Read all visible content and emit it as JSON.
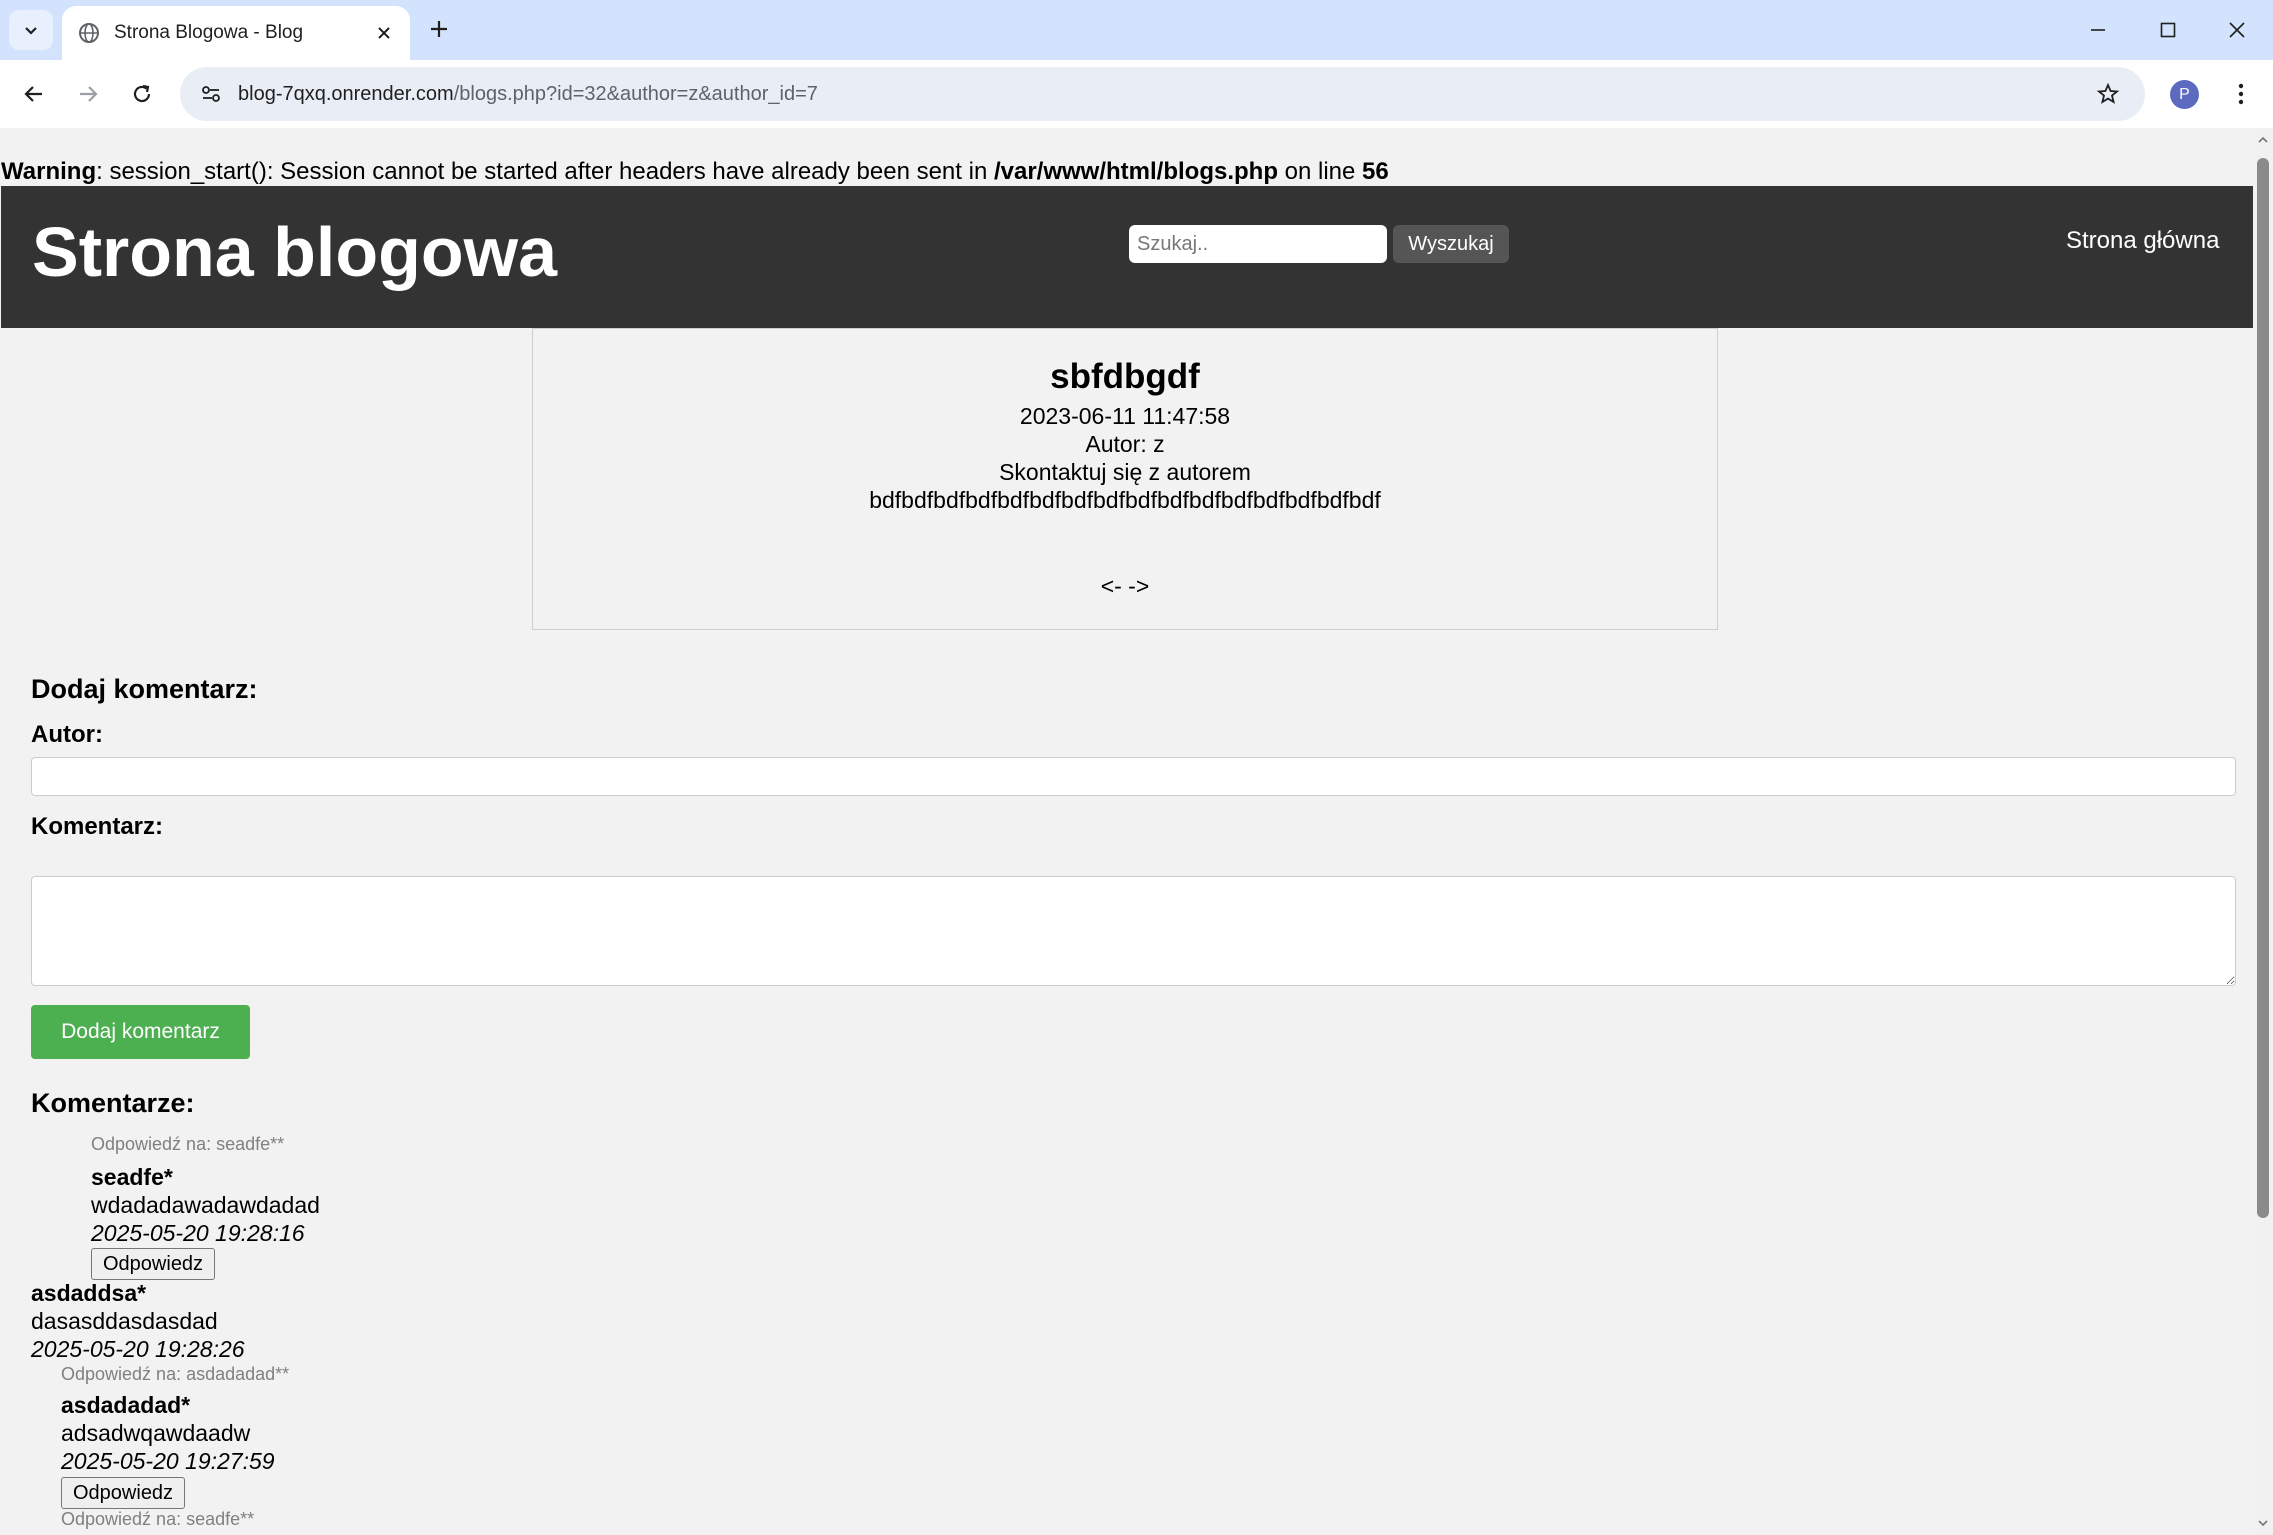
{
  "browser": {
    "tab_title": "Strona Blogowa - Blog",
    "url_host": "blog-7qxq.onrender.com",
    "url_path": "/blogs.php?id=32&author=z&author_id=7",
    "profile_initial": "P"
  },
  "warning": {
    "label": "Warning",
    "message": ": session_start(): Session cannot be started after headers have already been sent in ",
    "file": "/var/www/html/blogs.php",
    "on_line": " on line ",
    "line": "56"
  },
  "header": {
    "title": "Strona blogowa",
    "search_placeholder": "Szukaj..",
    "search_button": "Wyszukaj",
    "home_link": "Strona główna"
  },
  "post": {
    "title": "sbfdbgdf",
    "date": "2023-06-11 11:47:58",
    "author": "Autor: z",
    "contact": "Skontaktuj się z autorem",
    "body": "bdfbdfbdfbdfbdfbdfbdfbdfbdfbdfbdfbdfbdfbdfbdfbdf",
    "nav": "<- ->"
  },
  "comment_form": {
    "heading": "Dodaj komentarz:",
    "author_label": "Autor:",
    "comment_label": "Komentarz:",
    "submit": "Dodaj komentarz"
  },
  "comments": {
    "heading": "Komentarze:",
    "reply_button": "Odpowiedz",
    "items": [
      {
        "reply_to": "Odpowiedź na: seadfe**",
        "author": "seadfe*",
        "text": "wdadadawadawdadad",
        "date": "2025-05-20 19:28:16"
      },
      {
        "author": "asdaddsa*",
        "text": "dasasddasdasdad",
        "date": "2025-05-20 19:28:26"
      },
      {
        "reply_to": "Odpowiedź na: asdadadad**",
        "author": "asdadadad*",
        "text": "adsadwqawdaadw",
        "date": "2025-05-20 19:27:59"
      },
      {
        "reply_to": "Odpowiedź na: seadfe**"
      }
    ]
  }
}
